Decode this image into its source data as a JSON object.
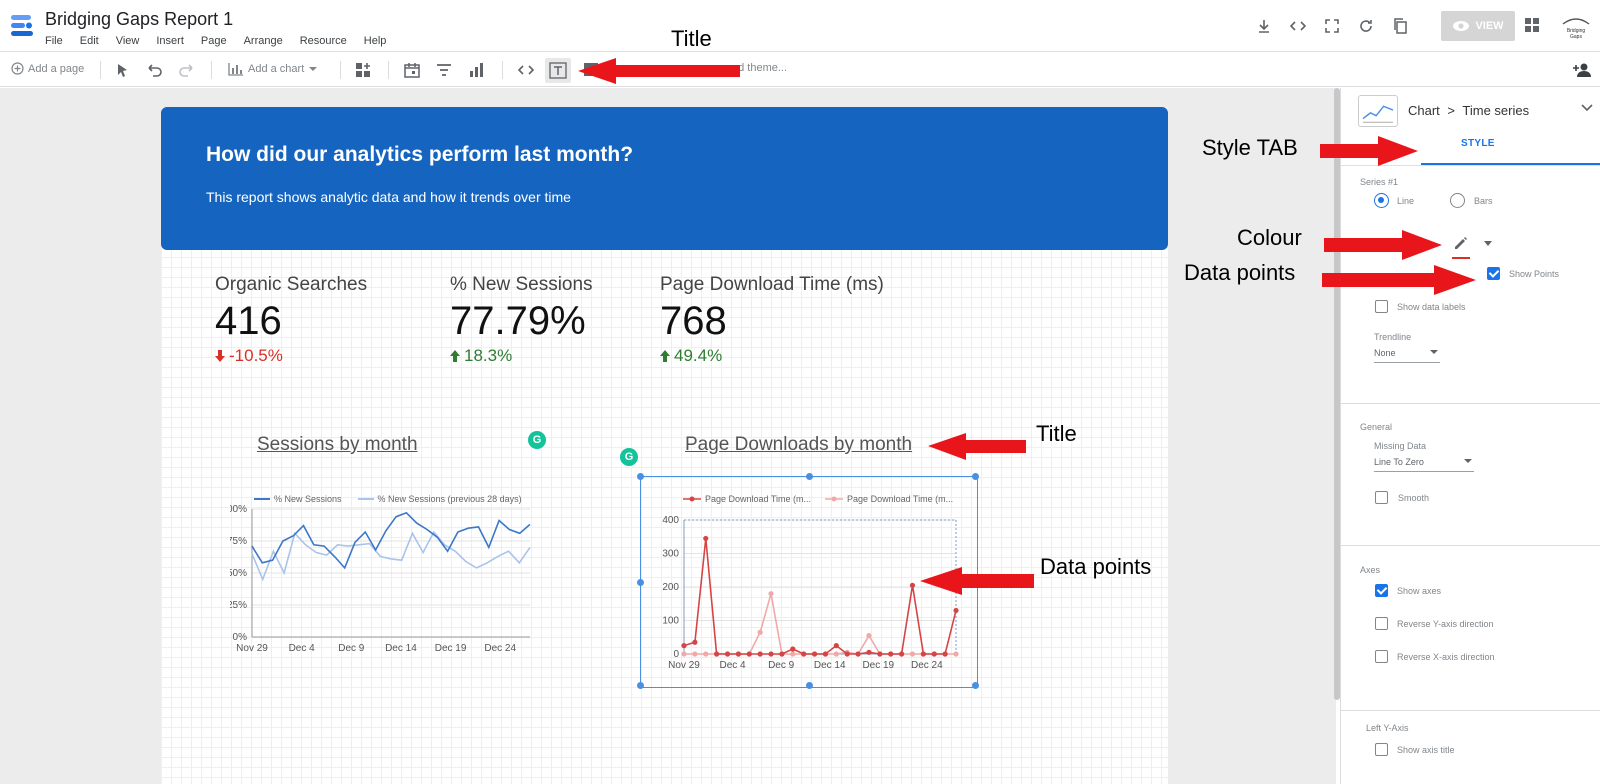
{
  "header": {
    "title": "Bridging Gaps Report 1",
    "menu": [
      "File",
      "Edit",
      "View",
      "Insert",
      "Page",
      "Arrange",
      "Resource",
      "Help"
    ],
    "view_label": "VIEW",
    "brand_text": "Bridging Gaps"
  },
  "toolbar": {
    "add_page": "Add a page",
    "add_chart": "Add a chart",
    "theme": "nd theme..."
  },
  "banner": {
    "title": "How did our analytics perform last month?",
    "subtitle": "This report shows analytic data and how it trends over time"
  },
  "kpis": [
    {
      "label": "Organic Searches",
      "value": "416",
      "delta": "-10.5%",
      "direction": "down"
    },
    {
      "label": "% New Sessions",
      "value": "77.79%",
      "delta": "18.3%",
      "direction": "up"
    },
    {
      "label": "Page Download Time (ms)",
      "value": "768",
      "delta": "49.4%",
      "direction": "up"
    }
  ],
  "charts": {
    "sessions_title": "Sessions by month",
    "downloads_title": "Page Downloads by month",
    "grammarly_badge": "G"
  },
  "chart_data": [
    {
      "type": "line",
      "title": "Sessions by month",
      "x_ticks": [
        "Nov 29",
        "Dec 4",
        "Dec 9",
        "Dec 14",
        "Dec 19",
        "Dec 24"
      ],
      "y_ticks": [
        "100%",
        "75%",
        "50%",
        "25%",
        "0%"
      ],
      "ylim": [
        0,
        100
      ],
      "series": [
        {
          "name": "% New Sessions",
          "color": "#3c78c8",
          "values": [
            71,
            58,
            60,
            75,
            79,
            87,
            72,
            71,
            63,
            54,
            74,
            82,
            68,
            83,
            94,
            97,
            89,
            84,
            78,
            67,
            82,
            85,
            86,
            70,
            91,
            84,
            81,
            88
          ]
        },
        {
          "name": "% New Sessions (previous 28 days)",
          "color": "#a9c4ea",
          "values": [
            65,
            45,
            67,
            50,
            81,
            72,
            66,
            64,
            72,
            71,
            72,
            73,
            63,
            61,
            60,
            81,
            66,
            82,
            72,
            67,
            59,
            54,
            58,
            63,
            67,
            58,
            70
          ]
        }
      ]
    },
    {
      "type": "line",
      "title": "Page Downloads by month",
      "x_ticks": [
        "Nov 29",
        "Dec 4",
        "Dec 9",
        "Dec 14",
        "Dec 19",
        "Dec 24"
      ],
      "y_ticks": [
        "400",
        "300",
        "200",
        "100",
        "0"
      ],
      "ylim": [
        0,
        400
      ],
      "series": [
        {
          "name": "Page Download Time (m...",
          "color": "#d64545",
          "values": [
            25,
            35,
            345,
            0,
            0,
            0,
            0,
            0,
            0,
            0,
            15,
            0,
            0,
            0,
            25,
            0,
            0,
            5,
            0,
            0,
            0,
            205,
            0,
            0,
            0,
            130
          ]
        },
        {
          "name": "Page Download Time (m...",
          "color": "#f0a8a8",
          "values": [
            0,
            0,
            0,
            0,
            0,
            0,
            0,
            65,
            180,
            0,
            0,
            0,
            0,
            0,
            0,
            5,
            0,
            55,
            0,
            0,
            0,
            0,
            0,
            0,
            0,
            0
          ]
        }
      ]
    }
  ],
  "panel": {
    "crumb_chart": "Chart",
    "crumb_type": "Time series",
    "tab_style": "STYLE",
    "series_label": "Series #1",
    "radio_line": "Line",
    "radio_bars": "Bars",
    "show_points": "Show Points",
    "show_data_labels": "Show data labels",
    "trendline_label": "Trendline",
    "trendline_value": "None",
    "general_label": "General",
    "missing_data_label": "Missing Data",
    "missing_data_value": "Line To Zero",
    "smooth": "Smooth",
    "axes_label": "Axes",
    "show_axes": "Show axes",
    "reverse_y": "Reverse Y-axis direction",
    "reverse_x": "Reverse X-axis direction",
    "left_y_label": "Left Y-Axis",
    "show_axis_title": "Show axis title"
  },
  "annotations": {
    "title_top": "Title",
    "style_tab": "Style TAB",
    "colour": "Colour",
    "data_points_panel": "Data points",
    "title_chart": "Title",
    "data_points_chart": "Data points"
  },
  "colors": {
    "brand_blue": "#1565c0",
    "accent": "#1a73e8",
    "arrow_red": "#e8151b",
    "negative": "#d93025",
    "positive": "#2e7d32"
  }
}
